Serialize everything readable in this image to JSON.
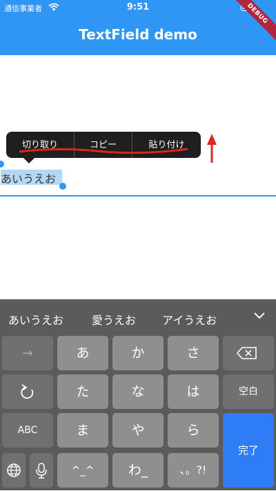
{
  "status": {
    "carrier": "通信事業者",
    "time": "9:51"
  },
  "banner": "DEBUG",
  "appbar": {
    "title": "TextField demo"
  },
  "toolbar": {
    "cut": "切り取り",
    "copy": "コピー",
    "paste": "貼り付け"
  },
  "field": {
    "value": "あいうえお"
  },
  "candidates": [
    "あいうえお",
    "愛うえお",
    "アイうえお"
  ],
  "keys": {
    "row1": [
      "→",
      "あ",
      "か",
      "さ"
    ],
    "row2": [
      "た",
      "な",
      "は"
    ],
    "space": "空白",
    "row3": [
      "ABC",
      "ま",
      "や",
      "ら"
    ],
    "done": "完了",
    "row4": [
      "^_^",
      "わ_",
      "、。?!"
    ]
  },
  "colors": {
    "accent": "#2f96f3",
    "annotation": "#e0251b",
    "done_key": "#2f7df6"
  }
}
